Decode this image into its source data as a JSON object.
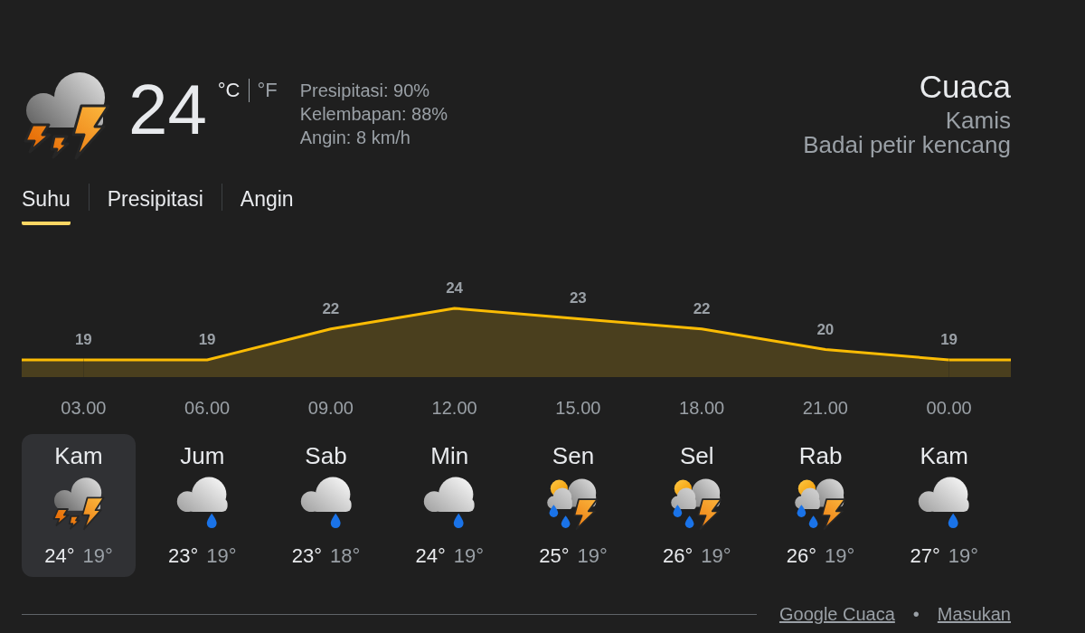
{
  "current": {
    "temperature": "24",
    "units": [
      {
        "label": "°C",
        "selected": true
      },
      {
        "label": "°F",
        "selected": false
      }
    ],
    "details": [
      "Presipitasi: 90%",
      "Kelembapan: 88%",
      "Angin: 8 km/h"
    ]
  },
  "heading": {
    "title": "Cuaca",
    "day": "Kamis",
    "condition": "Badai petir kencang"
  },
  "tabs": [
    {
      "label": "Suhu",
      "selected": true
    },
    {
      "label": "Presipitasi",
      "selected": false
    },
    {
      "label": "Angin",
      "selected": false
    }
  ],
  "temperature_chart": {
    "chart_data": {
      "type": "area",
      "categories": [
        "03.00",
        "06.00",
        "09.00",
        "12.00",
        "15.00",
        "18.00",
        "21.00",
        "00.00"
      ],
      "values": [
        19,
        19,
        22,
        24,
        23,
        22,
        20,
        19
      ],
      "data_labels": true
    }
  },
  "days": [
    {
      "name": "Kam",
      "kind": "storm",
      "high": "24°",
      "low": "19°",
      "selected": true
    },
    {
      "name": "Jum",
      "kind": "rain",
      "high": "23°",
      "low": "19°",
      "selected": false
    },
    {
      "name": "Sab",
      "kind": "rain",
      "high": "23°",
      "low": "18°",
      "selected": false
    },
    {
      "name": "Min",
      "kind": "rain",
      "high": "24°",
      "low": "19°",
      "selected": false
    },
    {
      "name": "Sen",
      "kind": "sun-storm",
      "high": "25°",
      "low": "19°",
      "selected": false
    },
    {
      "name": "Sel",
      "kind": "sun-storm",
      "high": "26°",
      "low": "19°",
      "selected": false
    },
    {
      "name": "Rab",
      "kind": "sun-storm",
      "high": "26°",
      "low": "19°",
      "selected": false
    },
    {
      "name": "Kam",
      "kind": "rain",
      "high": "27°",
      "low": "19°",
      "selected": false
    }
  ],
  "footer": {
    "links": [
      "Google Cuaca",
      "Masukan"
    ],
    "separator": "•"
  }
}
